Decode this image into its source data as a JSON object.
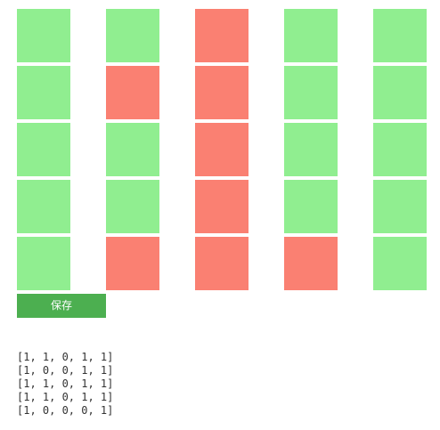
{
  "colors": {
    "cell_on": "#90EE90",
    "cell_off": "#FA8072",
    "save_button_bg": "#4CAF50",
    "save_button_text": "#FFFFFF"
  },
  "grid": {
    "rows": 5,
    "cols": 5,
    "values": [
      [
        1,
        1,
        0,
        1,
        1
      ],
      [
        1,
        0,
        0,
        1,
        1
      ],
      [
        1,
        1,
        0,
        1,
        1
      ],
      [
        1,
        1,
        0,
        1,
        1
      ],
      [
        1,
        0,
        0,
        0,
        1
      ]
    ]
  },
  "save_button": {
    "label": "保存"
  },
  "output": {
    "lines": [
      "[1, 1, 0, 1, 1]",
      "[1, 0, 0, 1, 1]",
      "[1, 1, 0, 1, 1]",
      "[1, 1, 0, 1, 1]",
      "[1, 0, 0, 0, 1]"
    ]
  }
}
